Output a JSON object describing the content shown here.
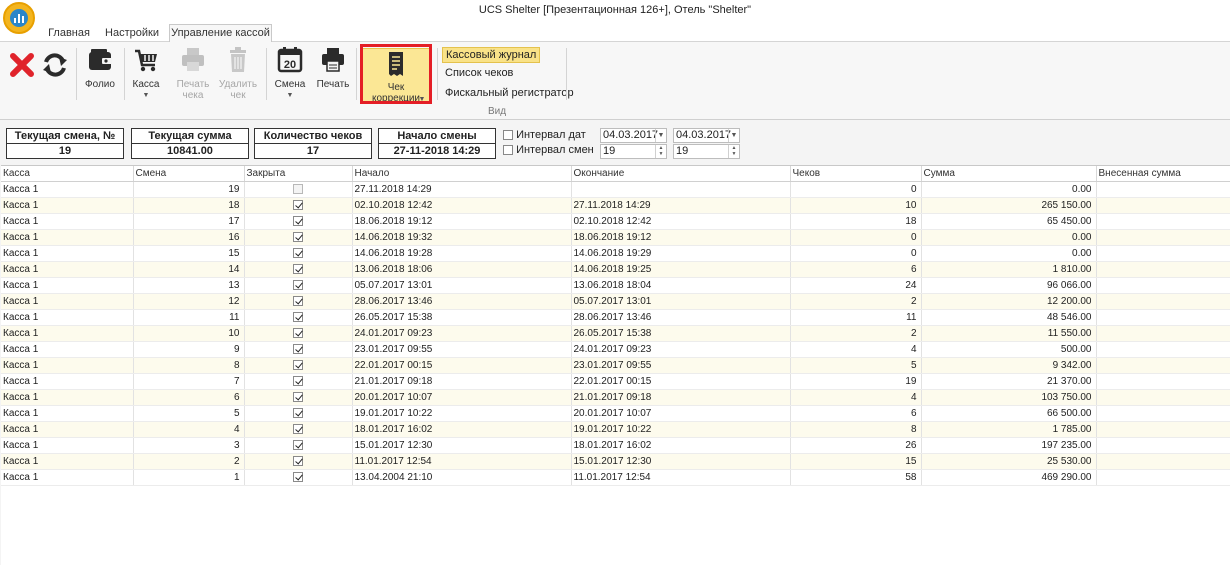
{
  "window": {
    "title": "UCS Shelter [Презентационная 126+], Отель \"Shelter\""
  },
  "tabs": [
    {
      "label": "Главная"
    },
    {
      "label": "Настройки"
    },
    {
      "label": "Управление кассой",
      "active": true
    }
  ],
  "toolbar": {
    "close_icon": "red-x-icon",
    "refresh_icon": "refresh-icon",
    "folio": "Фолио",
    "kassa": "Касса",
    "print_check": "Печать\nчека",
    "delete_check": "Удалить\nчек",
    "shift": "Смена",
    "shift_icon_day": "20",
    "print": "Печать",
    "correction_check": "Чек\nкоррекции"
  },
  "view_group": {
    "label": "Вид",
    "items": [
      {
        "label": "Кассовый журнал",
        "active": true
      },
      {
        "label": "Список чеков"
      },
      {
        "label": "Фискальный регистратор"
      }
    ]
  },
  "info": {
    "current_shift_title": "Текущая смена, №",
    "current_shift_value": "19",
    "current_sum_title": "Текущая сумма",
    "current_sum_value": "10841.00",
    "checks_count_title": "Количество чеков",
    "checks_count_value": "17",
    "shift_start_title": "Начало смены",
    "shift_start_value": "27-11-2018 14:29"
  },
  "filters": {
    "date_interval_label": "Интервал дат",
    "shift_interval_label": "Интервал смен",
    "date_from": "04.03.2017",
    "date_to": "04.03.2017",
    "shift_from": "19",
    "shift_to": "19"
  },
  "grid": {
    "columns": [
      "Касса",
      "Смена",
      "Закрыта",
      "Начало",
      "Окончание",
      "Чеков",
      "Сумма",
      "Внесенная сумма"
    ],
    "rows": [
      {
        "kassa": "Касса 1",
        "shift": "19",
        "closed": false,
        "start": "27.11.2018 14:29",
        "end": "",
        "checks": "0",
        "sum": "0.00"
      },
      {
        "kassa": "Касса 1",
        "shift": "18",
        "closed": true,
        "start": "02.10.2018 12:42",
        "end": "27.11.2018 14:29",
        "checks": "10",
        "sum": "265 150.00"
      },
      {
        "kassa": "Касса 1",
        "shift": "17",
        "closed": true,
        "start": "18.06.2018 19:12",
        "end": "02.10.2018 12:42",
        "checks": "18",
        "sum": "65 450.00"
      },
      {
        "kassa": "Касса 1",
        "shift": "16",
        "closed": true,
        "start": "14.06.2018 19:32",
        "end": "18.06.2018 19:12",
        "checks": "0",
        "sum": "0.00"
      },
      {
        "kassa": "Касса 1",
        "shift": "15",
        "closed": true,
        "start": "14.06.2018 19:28",
        "end": "14.06.2018 19:29",
        "checks": "0",
        "sum": "0.00"
      },
      {
        "kassa": "Касса 1",
        "shift": "14",
        "closed": true,
        "start": "13.06.2018 18:06",
        "end": "14.06.2018 19:25",
        "checks": "6",
        "sum": "1 810.00"
      },
      {
        "kassa": "Касса 1",
        "shift": "13",
        "closed": true,
        "start": "05.07.2017 13:01",
        "end": "13.06.2018 18:04",
        "checks": "24",
        "sum": "96 066.00"
      },
      {
        "kassa": "Касса 1",
        "shift": "12",
        "closed": true,
        "start": "28.06.2017 13:46",
        "end": "05.07.2017 13:01",
        "checks": "2",
        "sum": "12 200.00"
      },
      {
        "kassa": "Касса 1",
        "shift": "11",
        "closed": true,
        "start": "26.05.2017 15:38",
        "end": "28.06.2017 13:46",
        "checks": "11",
        "sum": "48 546.00"
      },
      {
        "kassa": "Касса 1",
        "shift": "10",
        "closed": true,
        "start": "24.01.2017 09:23",
        "end": "26.05.2017 15:38",
        "checks": "2",
        "sum": "11 550.00"
      },
      {
        "kassa": "Касса 1",
        "shift": "9",
        "closed": true,
        "start": "23.01.2017 09:55",
        "end": "24.01.2017 09:23",
        "checks": "4",
        "sum": "500.00"
      },
      {
        "kassa": "Касса 1",
        "shift": "8",
        "closed": true,
        "start": "22.01.2017 00:15",
        "end": "23.01.2017 09:55",
        "checks": "5",
        "sum": "9 342.00"
      },
      {
        "kassa": "Касса 1",
        "shift": "7",
        "closed": true,
        "start": "21.01.2017 09:18",
        "end": "22.01.2017 00:15",
        "checks": "19",
        "sum": "21 370.00"
      },
      {
        "kassa": "Касса 1",
        "shift": "6",
        "closed": true,
        "start": "20.01.2017 10:07",
        "end": "21.01.2017 09:18",
        "checks": "4",
        "sum": "103 750.00"
      },
      {
        "kassa": "Касса 1",
        "shift": "5",
        "closed": true,
        "start": "19.01.2017 10:22",
        "end": "20.01.2017 10:07",
        "checks": "6",
        "sum": "66 500.00"
      },
      {
        "kassa": "Касса 1",
        "shift": "4",
        "closed": true,
        "start": "18.01.2017 16:02",
        "end": "19.01.2017 10:22",
        "checks": "8",
        "sum": "1 785.00"
      },
      {
        "kassa": "Касса 1",
        "shift": "3",
        "closed": true,
        "start": "15.01.2017 12:30",
        "end": "18.01.2017 16:02",
        "checks": "26",
        "sum": "197 235.00"
      },
      {
        "kassa": "Касса 1",
        "shift": "2",
        "closed": true,
        "start": "11.01.2017 12:54",
        "end": "15.01.2017 12:30",
        "checks": "15",
        "sum": "25 530.00"
      },
      {
        "kassa": "Касса 1",
        "shift": "1",
        "closed": true,
        "start": "13.04.2004 21:10",
        "end": "11.01.2017 12:54",
        "checks": "58",
        "sum": "469 290.00"
      }
    ]
  }
}
